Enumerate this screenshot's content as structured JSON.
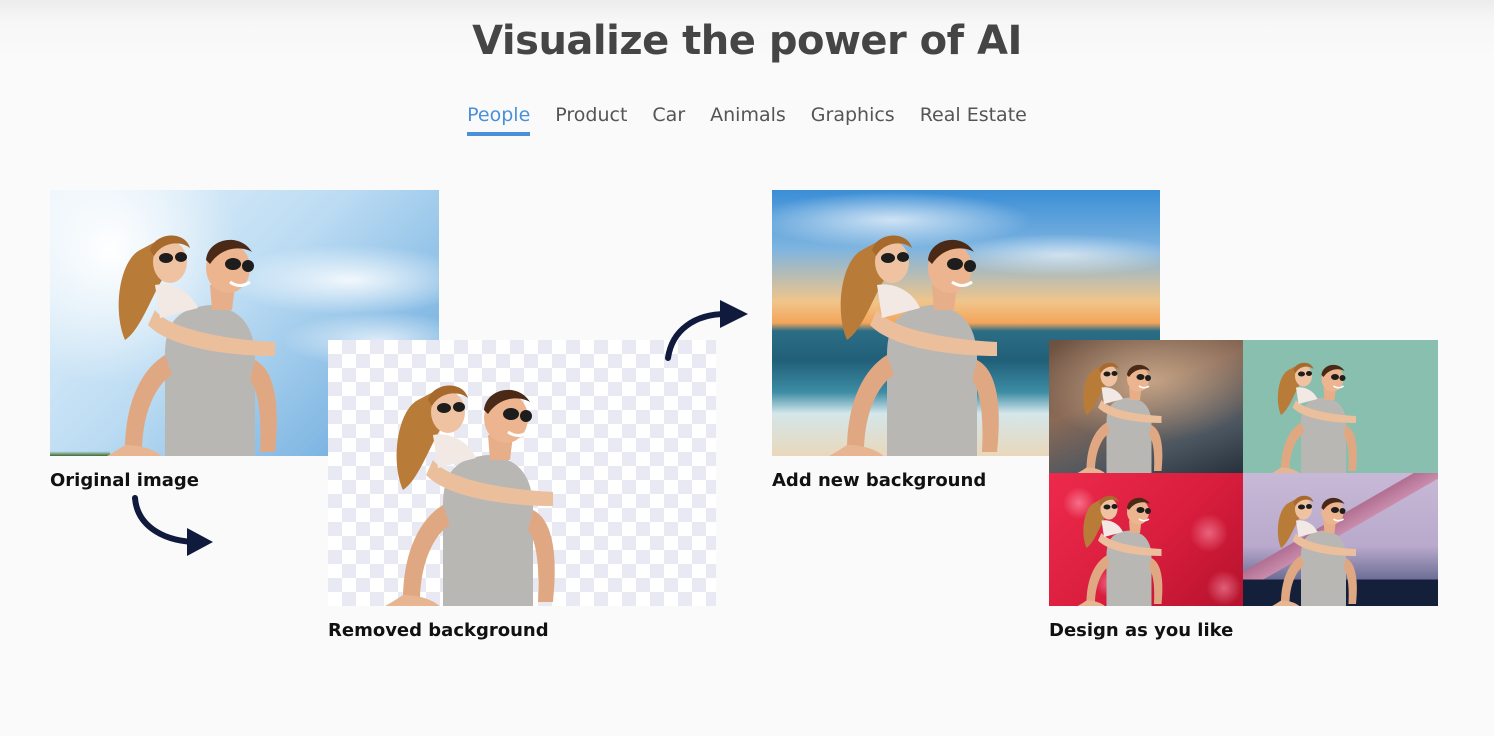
{
  "page": {
    "title": "Visualize the power of AI"
  },
  "tabs": [
    {
      "label": "People",
      "active": true
    },
    {
      "label": "Product",
      "active": false
    },
    {
      "label": "Car",
      "active": false
    },
    {
      "label": "Animals",
      "active": false
    },
    {
      "label": "Graphics",
      "active": false
    },
    {
      "label": "Real Estate",
      "active": false
    }
  ],
  "steps": {
    "original": {
      "caption": "Original image"
    },
    "removed": {
      "caption": "Removed background"
    },
    "new_background": {
      "caption": "Add new background"
    },
    "design": {
      "caption": "Design as you like"
    }
  },
  "colors": {
    "accent": "#4a90d9",
    "title": "#454545",
    "tab_text": "#555555",
    "arrow": "#0f1a3d"
  },
  "icons": {
    "arrow": "curved-arrow-icon",
    "photo": "couple-photo"
  }
}
